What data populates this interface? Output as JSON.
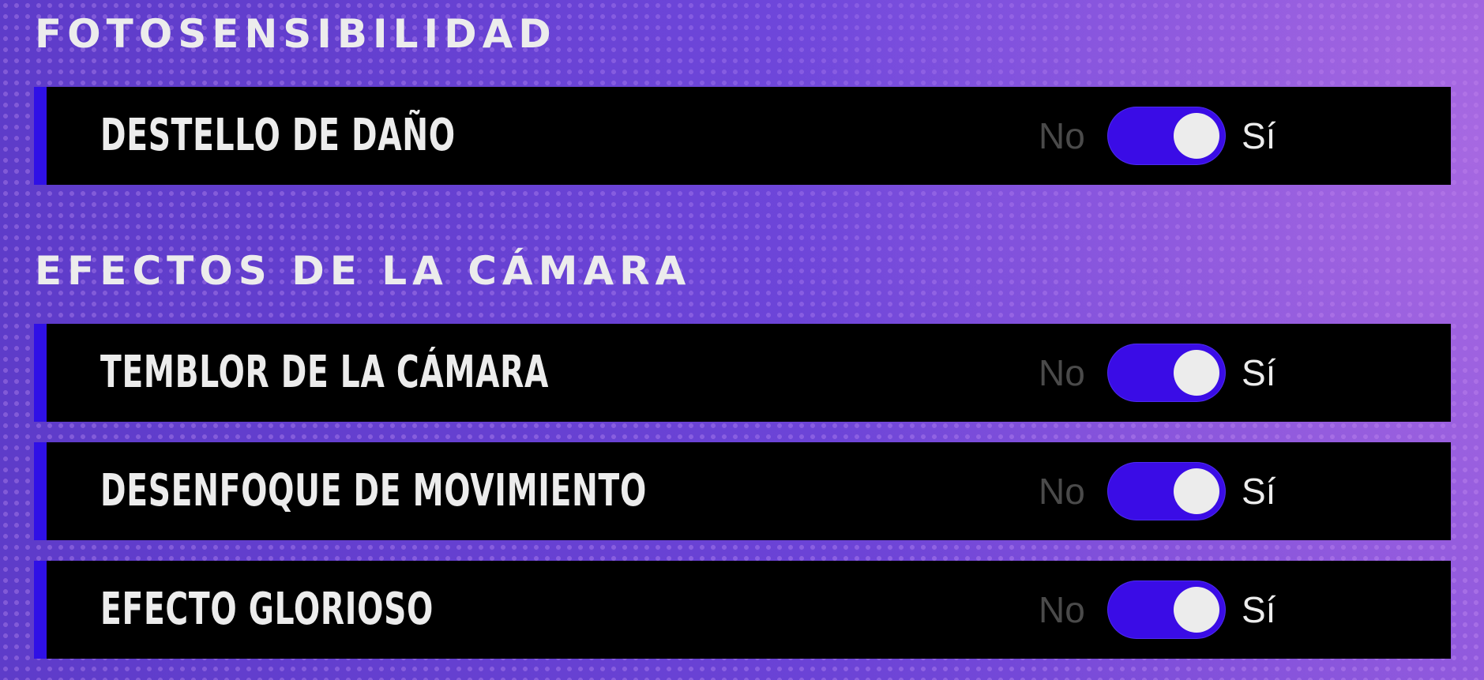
{
  "sections": [
    {
      "title": "FOTOSENSIBILIDAD",
      "items": [
        {
          "label": "DESTELLO DE DAÑO",
          "off_label": "No",
          "on_label": "Sí",
          "value": "Sí"
        }
      ]
    },
    {
      "title": "EFECTOS DE LA CÁMARA",
      "items": [
        {
          "label": "TEMBLOR DE LA CÁMARA",
          "off_label": "No",
          "on_label": "Sí",
          "value": "Sí"
        },
        {
          "label": "DESENFOQUE DE MOVIMIENTO",
          "off_label": "No",
          "on_label": "Sí",
          "value": "Sí"
        },
        {
          "label": "EFECTO GLORIOSO",
          "off_label": "No",
          "on_label": "Sí",
          "value": "Sí"
        }
      ]
    }
  ],
  "colors": {
    "accent": "#3a0ce6",
    "row_background": "#000000",
    "text": "#ececec",
    "inactive_text": "#4a4a4a"
  }
}
